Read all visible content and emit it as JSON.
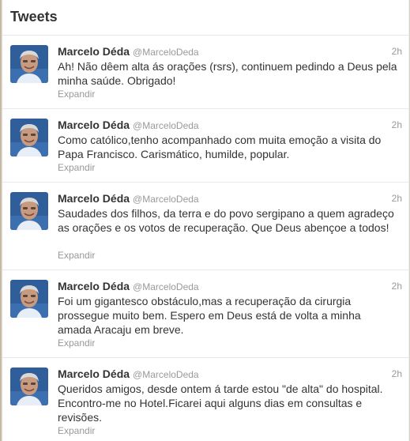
{
  "header": {
    "title": "Tweets"
  },
  "tweets": [
    {
      "name": "Marcelo Déda",
      "username": "@MarceloDeda",
      "time": "2h",
      "text": "Ah! Não dêem alta ás orações (rsrs), continuem pedindo a Deus pela minha saúde. Obrigado!",
      "expand": "Expandir"
    },
    {
      "name": "Marcelo Déda",
      "username": "@MarceloDeda",
      "time": "2h",
      "text": "Como católico,tenho acompanhado com muita emoção a visita do Papa Francisco. Carismático, humilde, popular.",
      "expand": "Expandir"
    },
    {
      "name": "Marcelo Déda",
      "username": "@MarceloDeda",
      "time": "2h",
      "text": "Saudades dos filhos, da terra e do povo sergipano a quem agradeço as orações e os votos de recuperação. Que Deus abençoe a todos!",
      "expand": "Expandir"
    },
    {
      "name": "Marcelo Déda",
      "username": "@MarceloDeda",
      "time": "2h",
      "text": "Foi um gigantesco obstáculo,mas a recuperação da cirurgia prossegue muito bem. Espero em Deus está de volta a minha amada Aracaju em breve.",
      "expand": "Expandir"
    },
    {
      "name": "Marcelo Déda",
      "username": "@MarceloDeda",
      "time": "2h",
      "text": "Queridos amigos, desde ontem á tarde estou \"de alta\" do hospital. Encontro-me no Hotel.Ficarei aqui alguns dias em consultas e revisões.",
      "expand": "Expandir"
    }
  ]
}
